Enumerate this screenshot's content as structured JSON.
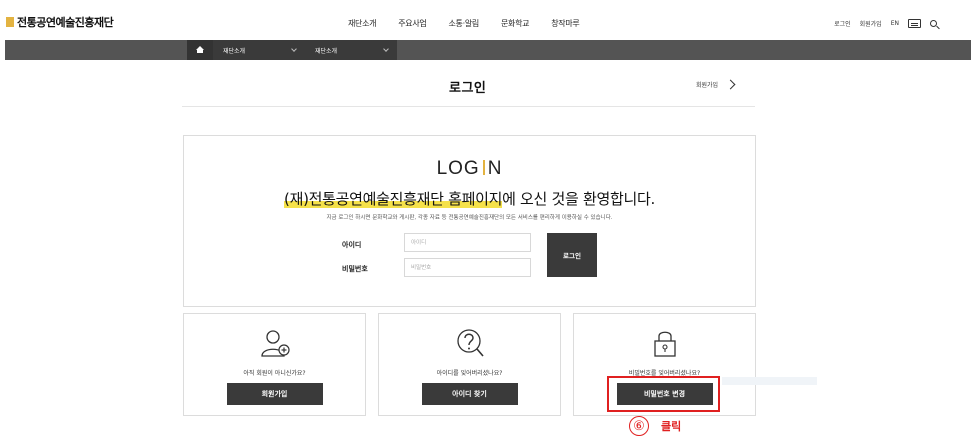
{
  "header": {
    "logo_text": "전통공연예술진흥재단",
    "nav": [
      "재단소개",
      "주요사업",
      "소통·알림",
      "문화학교",
      "창작마루"
    ],
    "util": {
      "login": "로그인",
      "join": "회원가입",
      "lang": "EN"
    }
  },
  "location": {
    "seg1": "재단소개",
    "seg2": "재단소개"
  },
  "page": {
    "title": "로그인",
    "join_link": "회원가입"
  },
  "login": {
    "logo_left": "LOG",
    "logo_right": "N",
    "welcome_highlight": "(재)전통공연예술진흥재단 홈페이지",
    "welcome_rest": "에 오신 것을 환영합니다.",
    "description": "지금 로그인 하시면 문화학교와 게시판, 각종 자료 등 전통공연예술진흥재단의 모든 서비스를 편리하게 이용하실 수 있습니다.",
    "id_label": "아이디",
    "id_placeholder": "아이디",
    "pw_label": "비밀번호",
    "pw_placeholder": "비밀번호",
    "submit": "로그인"
  },
  "options": [
    {
      "question": "아직 회원이 아니신가요?",
      "button": "회원가입",
      "icon": "user-plus-icon"
    },
    {
      "question": "아이디를 잊어버리셨나요?",
      "button": "아이디 찾기",
      "icon": "question-icon"
    },
    {
      "question": "비밀번호를 잊어버리셨나요?",
      "button": "비밀번호 변경",
      "icon": "lock-icon"
    }
  ],
  "annotation": {
    "number": "⑥",
    "text": "클릭",
    "color": "#e02020"
  },
  "colors": {
    "accent": "#e3b341",
    "dark": "#3a3a3a",
    "locbar": "#545454",
    "highlight": "#f5e14a"
  }
}
